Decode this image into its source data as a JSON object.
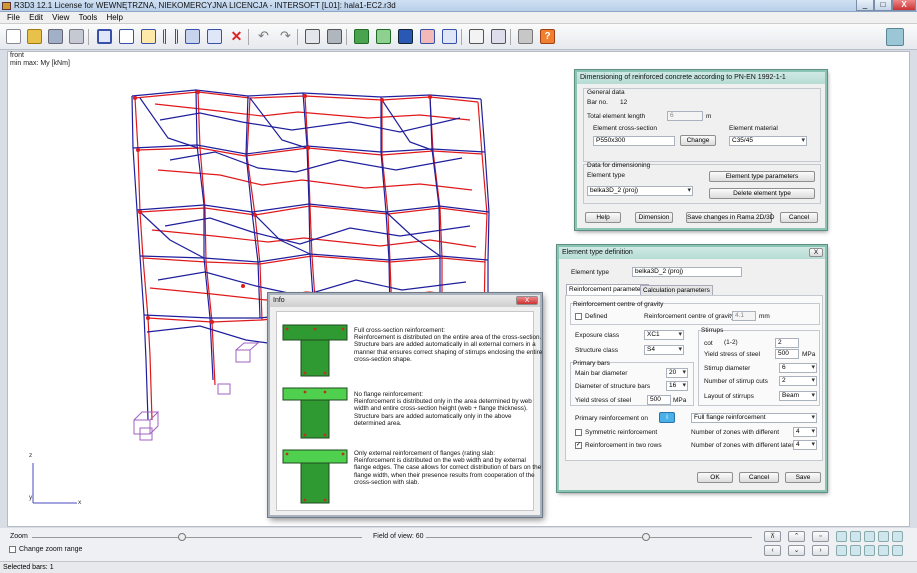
{
  "window": {
    "title": "R3D3 12.1 License for WEWNĘTRZNA, NIEKOMERCYJNA LICENCJA - INTERSOFT [L01]: hala1-EC2.r3d",
    "minimize": "_",
    "maximize": "□",
    "close": "X"
  },
  "menu": [
    "File",
    "Edit",
    "View",
    "Tools",
    "Help"
  ],
  "toolbar_icons": [
    "new-icon",
    "open-icon",
    "save-icon",
    "settings-icon",
    "frame-icon",
    "nodes-icon",
    "bars-icon",
    "columns-icon",
    "load-icon",
    "scale-icon",
    "delete-icon",
    "undo-icon",
    "redo-icon",
    "table-icon",
    "filter-icon",
    "model-icon",
    "display-icon",
    "structure-icon",
    "results-icon",
    "list-icon",
    "reinforcement-icon",
    "report-icon",
    "tools-icon",
    "help-icon"
  ],
  "view": {
    "line1": "front",
    "line2": "min max: My [kNm]"
  },
  "axes": {
    "z": "z",
    "y": "y",
    "x": "x"
  },
  "dim_dialog": {
    "title": "Dimensioning of reinforced concrete according to PN-EN 1992-1-1",
    "general_data": "General data",
    "bar_no_label": "Bar no.",
    "bar_no": "12",
    "total_length_label": "Total element length",
    "total_length": "6",
    "total_length_unit": "m",
    "cross_section_label": "Element cross-section",
    "cross_section": "P550x300",
    "change_button": "Change",
    "material_label": "Element material",
    "material": "C35/45",
    "data_for_dim": "Data for dimensioning",
    "element_type_label": "Element type",
    "element_type": "belka3D_2 (proj)",
    "element_type_params_button": "Element type parameters",
    "delete_type_button": "Delete element type",
    "help_button": "Help",
    "dimension_button": "Dimension",
    "save_button": "Save changes in Rama 2D/3D",
    "cancel_button": "Cancel"
  },
  "type_dialog": {
    "title": "Element type definition",
    "close": "X",
    "element_type_label": "Element type",
    "element_type": "belka3D_2 (proj)",
    "tab_reinforcement": "Reinforcement parameters",
    "tab_calculation": "Calculation parameters",
    "centre_group": "Reinforcement centre of gravity",
    "defined_label": "Defined",
    "centre_label": "Reinforcement centre of gravity",
    "centre_value": "4.1",
    "centre_unit": "mm",
    "exposure_label": "Exposure class",
    "exposure": "XC1",
    "structure_label": "Structure class",
    "structure": "S4",
    "primary_bars": "Primary bars",
    "main_bar_label": "Main bar diameter",
    "main_bar": "20",
    "structure_bars_label": "Diameter of structure bars",
    "structure_bars": "16",
    "yield_label": "Yield stress of steel",
    "yield": "500",
    "yield_unit": "MPa",
    "stirrups": "Stirrups",
    "cot_label": "cot",
    "cot_range": "(1-2)",
    "cot_value": "2",
    "stirrup_yield_label": "Yield stress of steel",
    "stirrup_yield": "500",
    "stirrup_yield_unit": "MPa",
    "stirrup_diam_label": "Stirrup diameter",
    "stirrup_diam": "6",
    "stirrup_cuts_label": "Number of stirrup cuts",
    "stirrup_cuts": "2",
    "layout_label": "Layout of stirrups",
    "layout": "Beam",
    "primary_on_label": "Primary reinforcement on",
    "primary_on": "Full flange reinforcement",
    "symmetric_label": "Symmetric reinforcement",
    "two_rows_label": "Reinforcement in two rows",
    "zones_label": "Number of zones with different",
    "zones": "4",
    "zones_lateral_label": "Number of zones with different lateral",
    "zones_lateral": "4",
    "ok_button": "OK",
    "cancel_button": "Cancel",
    "save_button": "Save"
  },
  "info_dialog": {
    "title": "Info",
    "close": "X",
    "items": [
      {
        "heading": "Full cross-section reinforcement:",
        "text": "Reinforcement is distributed on the entire area of the cross-section. Structure bars are added automatically in all external corners in a manner that ensures correct shaping of stirrups enclosing the entire cross-section shape."
      },
      {
        "heading": "No flange reinforcement:",
        "text": "Reinforcement is distributed only in the area determined by web width and entire cross-section height (web + flange thickness). Structure bars are added automatically only in the above determined area."
      },
      {
        "heading": "Only external reinforcement of flanges (rating slab:",
        "text": "Reinforcement is distributed on the web width and by external flange edges. The case allows for correct distribution of bars on the flange width, when their presence results from cooperation of the cross-section with slab."
      }
    ]
  },
  "bottom": {
    "zoom_label": "Zoom",
    "zoom_range_label": "Change zoom range",
    "fov_label": "Field of view: 60"
  },
  "status": "Selected bars: 1",
  "colors": {
    "red_line": "#e0191b",
    "blue_line": "#1f1f9e",
    "dialog_border": "#8bc4b4",
    "section_green": "#2f9a32"
  }
}
